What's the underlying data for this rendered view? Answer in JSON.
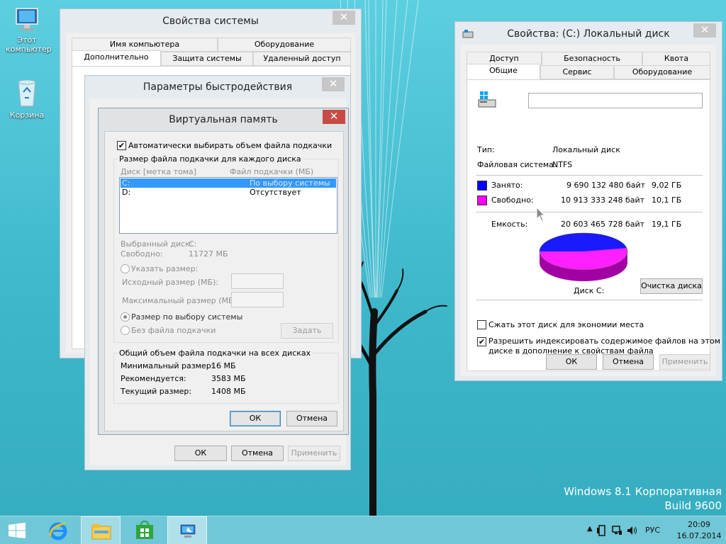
{
  "desktop": {
    "icons": [
      {
        "label": "Этот компьютер",
        "icon": "computer-icon"
      },
      {
        "label": "Корзина",
        "icon": "recycle-bin-icon"
      }
    ],
    "watermark_line1": "Windows 8.1 Корпоративная",
    "watermark_line2": "Build 9600"
  },
  "system_props": {
    "title": "Свойства системы",
    "close": "✕",
    "tabs_row1": [
      "Имя компьютера",
      "Оборудование"
    ],
    "tabs_row2": [
      "Дополнительно",
      "Защита системы",
      "Удаленный доступ"
    ],
    "selected_tab": "Дополнительно"
  },
  "perf": {
    "title": "Параметры быстродействия",
    "close": "✕",
    "ok": "ОК",
    "cancel": "Отмена",
    "apply": "Применить"
  },
  "vm": {
    "title": "Виртуальная память",
    "close": "✕",
    "auto_label": "Автоматически выбирать объем файла подкачки",
    "auto_checked": true,
    "group1_title": "Размер файла подкачки для каждого диска",
    "col_drive": "Диск [метка тома]",
    "col_paging": "Файл подкачки (МБ)",
    "drives": [
      {
        "drive": "C:",
        "paging": "По выбору системы",
        "selected": true
      },
      {
        "drive": "D:",
        "paging": "Отсутствует",
        "selected": false
      }
    ],
    "sel_drive_label": "Выбранный диск:",
    "sel_drive_value": "C:",
    "free_label": "Свободно:",
    "free_value": "11727 МБ",
    "custom_label": "Указать размер:",
    "initial_label": "Исходный размер (МБ):",
    "max_label": "Максимальный размер (МБ):",
    "system_label": "Размер по выбору системы",
    "none_label": "Без файла подкачки",
    "set_button": "Задать",
    "group2_title": "Общий объем файла подкачки на всех дисках",
    "min_label": "Минимальный размер:",
    "min_value": "16 МБ",
    "rec_label": "Рекомендуется:",
    "rec_value": "3583 МБ",
    "cur_label": "Текущий размер:",
    "cur_value": "1408 МБ",
    "ok": "ОК",
    "cancel": "Отмена"
  },
  "disk": {
    "title": "Свойства: (C:) Локальный диск",
    "close": "✕",
    "tabs_row1": [
      "Доступ",
      "Безопасность",
      "Квота"
    ],
    "tabs_row2": [
      "Общие",
      "Сервис",
      "Оборудование"
    ],
    "selected_tab": "Общие",
    "name_value": "",
    "type_label": "Тип:",
    "type_value": "Локальный диск",
    "fs_label": "Файловая система:",
    "fs_value": "NTFS",
    "used_label": "Занято:",
    "used_bytes": "9 690 132 480 байт",
    "used_gb": "9,02 ГБ",
    "free_label": "Свободно:",
    "free_bytes": "10 913 333 248 байт",
    "free_gb": "10,1 ГБ",
    "cap_label": "Емкость:",
    "cap_bytes": "20 603 465 728 байт",
    "cap_gb": "19,1 ГБ",
    "used_color": "#0000ff",
    "free_color": "#ff00ff",
    "disk_label": "Диск C:",
    "cleanup": "Очистка диска",
    "compress_label": "Сжать этот диск для экономии места",
    "compress_checked": false,
    "index_label_1": "Разрешить индексировать содержимое файлов на этом",
    "index_label_2": "диске в дополнение к свойствам файла",
    "index_checked": true,
    "ok": "ОК",
    "cancel": "Отмена",
    "apply": "Применить"
  },
  "taskbar": {
    "lang": "РУС",
    "time": "20:09",
    "date": "16.07.2014"
  }
}
